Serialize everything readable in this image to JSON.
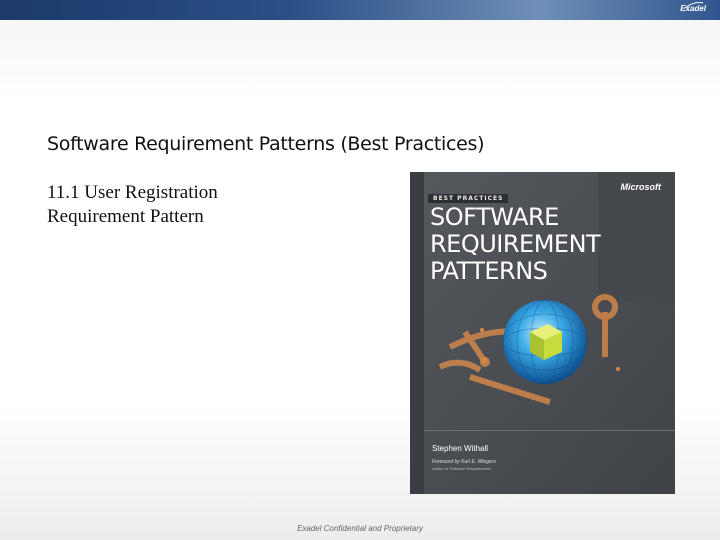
{
  "header": {
    "logo": "Exadel"
  },
  "slide": {
    "title": "Software Requirement Patterns (Best Practices)",
    "subtitle_line1": "11.1 User Registration",
    "subtitle_line2": "Requirement Pattern"
  },
  "book": {
    "series": "BEST PRACTICES",
    "publisher": "Microsoft",
    "title_line1": "SOFTWARE",
    "title_line2": "REQUIREMENT",
    "title_line3": "PATTERNS",
    "author": "Stephen Withall",
    "foreword": "Foreword by Karl E. Wiegers",
    "foreword_note": "Author of Software Requirements"
  },
  "footer": {
    "text": "Exadel Confidential and Proprietary"
  },
  "colors": {
    "header_bar": "#2a4f86",
    "book_cover": "#4d5156",
    "orange_accent": "#d98a4a",
    "globe": "#3aa6e0"
  }
}
